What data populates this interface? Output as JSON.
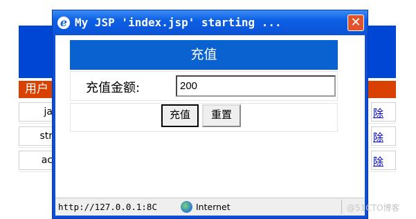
{
  "background": {
    "table_header": "用户",
    "rows": [
      {
        "left": "ja",
        "right": "除"
      },
      {
        "left": "str",
        "right": "除"
      },
      {
        "left": "ac",
        "right": "除"
      }
    ]
  },
  "popup": {
    "title": "My JSP 'index.jsp' starting ...",
    "form": {
      "heading": "充值",
      "amount_label": "充值金额:",
      "amount_value": "200",
      "submit_label": "充值",
      "reset_label": "重置"
    },
    "statusbar": {
      "url": "http://127.0.0.1:8C",
      "zone": "Internet"
    }
  },
  "watermark": "@51CTO博客",
  "colors": {
    "titlebar": "#0b52d6",
    "form_header": "#0a62d0",
    "table_header_bg": "#d84100",
    "link": "#0000cc",
    "close_button": "#e0532b"
  },
  "icons": [
    "ie-icon",
    "close-icon",
    "globe-icon"
  ]
}
